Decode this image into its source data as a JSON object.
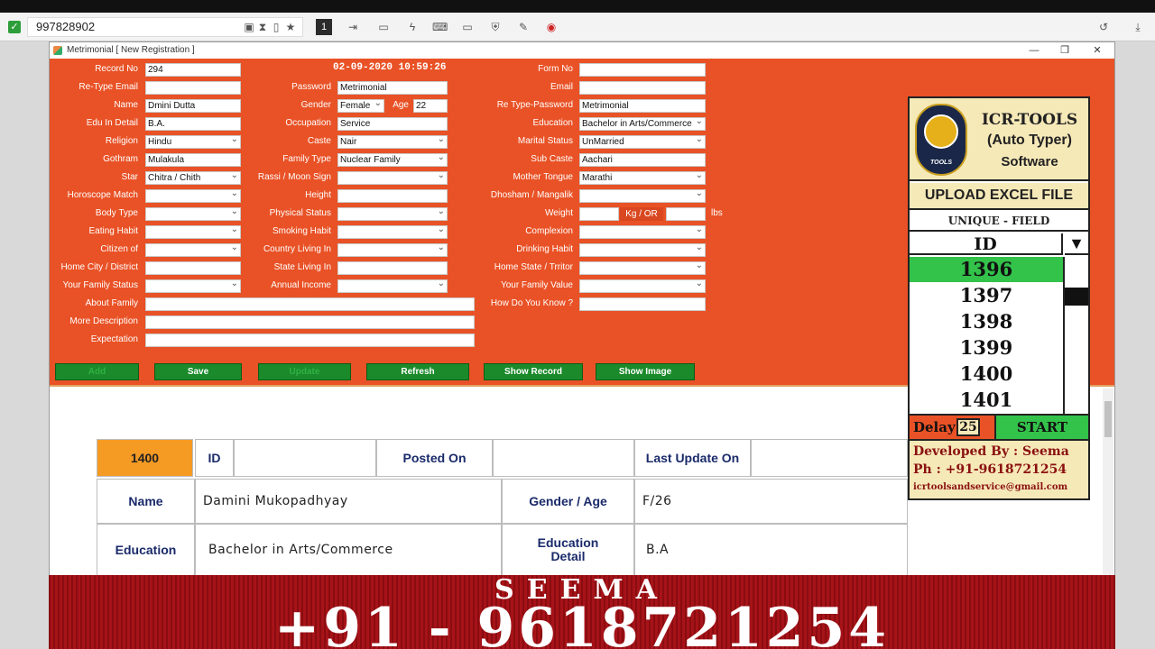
{
  "remote_bar": {
    "id_value": "997828902",
    "page_num": "1"
  },
  "window": {
    "title": "Metrimonial [ New Registration ]"
  },
  "form": {
    "datetime": "02-09-2020  10:59:26",
    "fields": [
      {
        "label": "Record No",
        "value": "294"
      },
      {
        "label": "Re-Type Email",
        "value": ""
      },
      {
        "label": "Name",
        "value": "Dmini Dutta"
      },
      {
        "label": "Edu In Detail",
        "value": "B.A."
      },
      {
        "label": "Religion",
        "value": "Hindu"
      },
      {
        "label": "Gothram",
        "value": "Mulakula"
      },
      {
        "label": "Star",
        "value": "Chitra / Chith"
      },
      {
        "label": "Horoscope Match",
        "value": ""
      },
      {
        "label": "Body Type",
        "value": ""
      },
      {
        "label": "Eating Habit",
        "value": ""
      },
      {
        "label": "Citizen of",
        "value": ""
      },
      {
        "label": "Home City / District",
        "value": ""
      },
      {
        "label": "Your Family Status",
        "value": ""
      },
      {
        "label": "About Family",
        "value": ""
      },
      {
        "label": "More Description",
        "value": ""
      },
      {
        "label": "Expectation",
        "value": ""
      }
    ],
    "mid_fields": [
      {
        "label": "Password",
        "value": "Metrimonial"
      },
      {
        "label": "Gender",
        "value": "Female"
      },
      {
        "label": "Occupation",
        "value": "Service"
      },
      {
        "label": "Caste",
        "value": "Nair"
      },
      {
        "label": "Family Type",
        "value": "Nuclear Family"
      },
      {
        "label": "Rassi / Moon Sign",
        "value": ""
      },
      {
        "label": "Height",
        "value": ""
      },
      {
        "label": "Physical Status",
        "value": ""
      },
      {
        "label": "Smoking Habit",
        "value": ""
      },
      {
        "label": "Country Living In",
        "value": ""
      },
      {
        "label": "State Living In",
        "value": ""
      },
      {
        "label": "Annual Income",
        "value": ""
      }
    ],
    "age_label": "Age",
    "age_value": "22",
    "right_fields": [
      {
        "label": "Form No",
        "value": ""
      },
      {
        "label": "Email",
        "value": ""
      },
      {
        "label": "Re Type-Password",
        "value": "Metrimonial"
      },
      {
        "label": "Education",
        "value": "Bachelor in Arts/Commerce"
      },
      {
        "label": "Marital Status",
        "value": "UnMarried"
      },
      {
        "label": "Sub Caste",
        "value": "Aachari"
      },
      {
        "label": "Mother Tongue",
        "value": "Marathi"
      },
      {
        "label": "Dhosham / Mangalik",
        "value": ""
      },
      {
        "label": "Weight",
        "value": ""
      },
      {
        "label": "Complexion",
        "value": ""
      },
      {
        "label": "Drinking Habit",
        "value": ""
      },
      {
        "label": "Home State / Trritor",
        "value": ""
      },
      {
        "label": "Your Family Value",
        "value": ""
      },
      {
        "label": "How Do You Know ?",
        "value": ""
      }
    ],
    "kg_or": "Kg / OR",
    "lbs": "lbs",
    "buttons": [
      "Add",
      "Save",
      "Update",
      "Refresh",
      "Show Record",
      "Show Image"
    ]
  },
  "report": {
    "record_id": "1400",
    "id_label": "ID",
    "posted_on_label": "Posted On",
    "last_update_label": "Last Update On",
    "name_label": "Name",
    "name_value": "Damini Mukopadhyay",
    "gender_age_label": "Gender / Age",
    "gender_age_value": "F/26",
    "education_label": "Education",
    "education_value": "Bachelor in Arts/Commerce",
    "education_detail_label": "Education Detail",
    "education_detail_value": "B.A"
  },
  "panel": {
    "brand_line1": "ICR-TOOLS",
    "brand_line2": "(Auto Typer)",
    "brand_line3": "Software",
    "logo_text": "TOOLS",
    "upload_label": "UPLOAD EXCEL FILE",
    "unique_label": "UNIQUE - FIELD",
    "id_header": "ID",
    "ids": [
      "1396",
      "1397",
      "1398",
      "1399",
      "1400",
      "1401"
    ],
    "selected_id": "1396",
    "delay_label": "Delay",
    "delay_value": "25",
    "start_label": "START",
    "dev_line": "Developed By : Seema",
    "phone_line": "Ph : +91-9618721254",
    "email_line": "icrtoolsandservice@gmail.com",
    "colors": {
      "green": "#33c24a",
      "orange": "#e95226",
      "gold": "#f6e9b8"
    }
  },
  "banner": {
    "line1": "SEEMA",
    "line2": "+91 - 9618721254"
  }
}
